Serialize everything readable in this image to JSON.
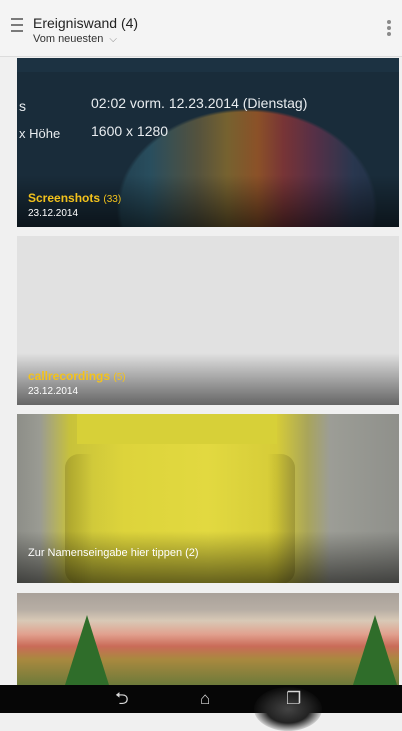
{
  "app_bar": {
    "title": "Ereigniswand (4)",
    "sort_label": "Vom neuesten",
    "sort_chevron": "⌵",
    "menu_icon": "hamburger-menu-icon",
    "overflow_icon": "more-vert-icon"
  },
  "cards": [
    {
      "name": "Screenshots",
      "count": "(33)",
      "date": "23.12.2014",
      "overlay_meta": {
        "top_fragment": "",
        "time_fragment": "s",
        "time_value": "02:02 vorm. 12.23.2014 (Dienstag)",
        "size_fragment": "x Höhe",
        "size_value": "1600 x 1280"
      }
    },
    {
      "name": "callrecordings",
      "count": "(5)",
      "date": "23.12.2014"
    },
    {
      "caption": "Zur Namenseingabe hier tippen (2)"
    },
    {}
  ],
  "nav_bar": {
    "back_glyph": "⮌",
    "home_glyph": "⌂",
    "recents_glyph": "❐"
  },
  "colors": {
    "album_name": "#f3c21c",
    "nav_background": "#060606"
  }
}
